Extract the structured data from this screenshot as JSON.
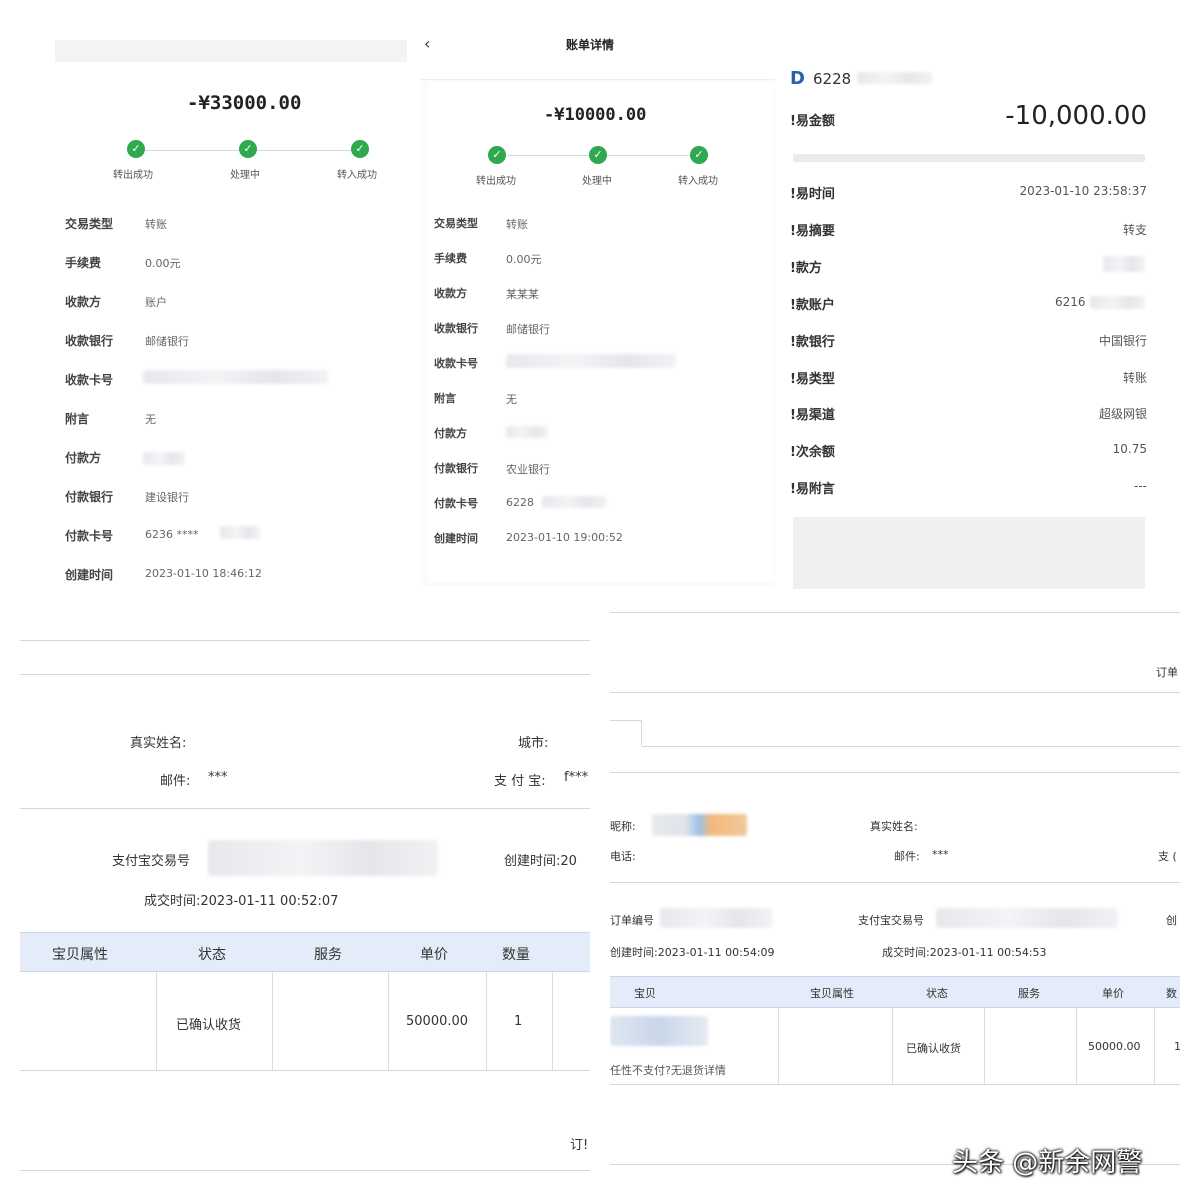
{
  "receipt1": {
    "amount": "-¥33000.00",
    "steps": [
      "转出成功",
      "处理中",
      "转入成功"
    ],
    "rows": [
      {
        "label": "交易类型",
        "value": "转账"
      },
      {
        "label": "手续费",
        "value": "0.00元"
      },
      {
        "label": "收款方",
        "value": "账户"
      },
      {
        "label": "收款银行",
        "value": "邮储银行"
      },
      {
        "label": "收款卡号",
        "value": ""
      },
      {
        "label": "附言",
        "value": "无"
      },
      {
        "label": "付款方",
        "value": ""
      },
      {
        "label": "付款银行",
        "value": "建设银行"
      },
      {
        "label": "付款卡号",
        "value": "6236 ****"
      },
      {
        "label": "创建时间",
        "value": "2023-01-10 18:46:12"
      }
    ]
  },
  "receipt2": {
    "back_icon": "chevron-left-icon",
    "title": "账单详情",
    "amount": "-¥10000.00",
    "steps": [
      "转出成功",
      "处理中",
      "转入成功"
    ],
    "rows": [
      {
        "label": "交易类型",
        "value": "转账"
      },
      {
        "label": "手续费",
        "value": "0.00元"
      },
      {
        "label": "收款方",
        "value": "某某某"
      },
      {
        "label": "收款银行",
        "value": "邮储银行"
      },
      {
        "label": "收款卡号",
        "value": ""
      },
      {
        "label": "附言",
        "value": "无"
      },
      {
        "label": "付款方",
        "value": ""
      },
      {
        "label": "付款银行",
        "value": "农业银行"
      },
      {
        "label": "付款卡号",
        "value": "6228"
      },
      {
        "label": "创建时间",
        "value": "2023-01-10 19:00:52"
      }
    ]
  },
  "receipt3": {
    "card_prefix": "6228",
    "rows": [
      {
        "label": "!易金额",
        "value": "-10,000.00"
      },
      {
        "label": "!易时间",
        "value": "2023-01-10 23:58:37"
      },
      {
        "label": "!易摘要",
        "value": "转支"
      },
      {
        "label": "!款方",
        "value": ""
      },
      {
        "label": "!款账户",
        "value": "6216"
      },
      {
        "label": "!款银行",
        "value": "中国银行"
      },
      {
        "label": "!易类型",
        "value": "转账"
      },
      {
        "label": "!易渠道",
        "value": "超级网银"
      },
      {
        "label": "!次余额",
        "value": "10.75"
      },
      {
        "label": "!易附言",
        "value": "---"
      }
    ]
  },
  "order1": {
    "real_name_label": "真实姓名:",
    "city_label": "城市:",
    "email_label": "邮件:",
    "email_value": "***",
    "alipay_label": "支 付 宝:",
    "alipay_value": "f***",
    "trade_no_label": "支付宝交易号",
    "created_label": "创建时间:20",
    "deal_time": "成交时间:2023-01-11 00:52:07",
    "headers": [
      "宝贝属性",
      "状态",
      "服务",
      "单价",
      "数量"
    ],
    "row": {
      "status": "已确认收货",
      "price": "50000.00",
      "qty": "1"
    },
    "footer": "订!"
  },
  "order2": {
    "top_right": "订单",
    "nickname_label": "昵称:",
    "real_name_label": "真实姓名:",
    "phone_label": "电话:",
    "email_label": "邮件:",
    "email_value": "***",
    "alipay_label": "支 (",
    "order_no_label": "订单编号",
    "trade_no_label": "支付宝交易号",
    "created_short": "创",
    "created_time": "创建时间:2023-01-11 00:54:09",
    "deal_time": "成交时间:2023-01-11 00:54:53",
    "headers": [
      "宝贝",
      "宝贝属性",
      "状态",
      "服务",
      "单价",
      "数"
    ],
    "row": {
      "note": "任性不支付?无退货详情",
      "status": "已确认收货",
      "price": "50000.00",
      "qty": "1"
    }
  },
  "watermark": "头条 @新余网警"
}
